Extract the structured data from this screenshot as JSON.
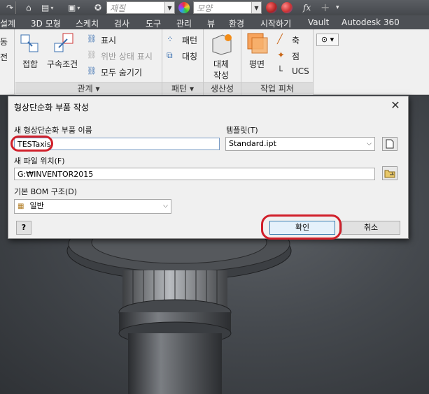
{
  "qat": {
    "material_placeholder": "재질",
    "appearance_placeholder": "모양",
    "fx_label": "fx"
  },
  "tabs": [
    "설계",
    "3D 모형",
    "스케치",
    "검사",
    "도구",
    "관리",
    "뷰",
    "환경",
    "시작하기",
    "Vault",
    "Autodesk 360"
  ],
  "ribbon": {
    "left_cut": [
      "동",
      "전"
    ],
    "constrain": {
      "join": "접합",
      "assembly_condition": "구속조건",
      "show": "표시",
      "show_violation": "위반 상태 표시",
      "hide_all": "모두 숨기기"
    },
    "panel_relations": "관계",
    "pattern": {
      "pattern": "패턴",
      "mirror": "대칭"
    },
    "panel_pattern": "패턴",
    "productivity": {
      "substitute_line1": "대체",
      "substitute_line2": "작성"
    },
    "panel_productivity": "생산성",
    "work_features": {
      "plane": "평면",
      "axis": "축",
      "point": "점",
      "ucs": "UCS"
    },
    "panel_work_features": "작업 피처"
  },
  "dialog": {
    "title": "형상단순화 부품 작성",
    "name_label": "새 형상단순화 부품 이름",
    "name_value": "TESTaxis",
    "template_label": "템플릿(T)",
    "template_value": "Standard.ipt",
    "location_label": "새 파일 위치(F)",
    "location_value": "G:₩INVENTOR2015",
    "bom_label": "기본 BOM 구조(D)",
    "bom_value": "일반",
    "help_label": "?",
    "ok_label": "확인",
    "cancel_label": "취소"
  },
  "colors": {
    "highlight": "#d11f2a",
    "primary_border": "#3c7fb1"
  }
}
